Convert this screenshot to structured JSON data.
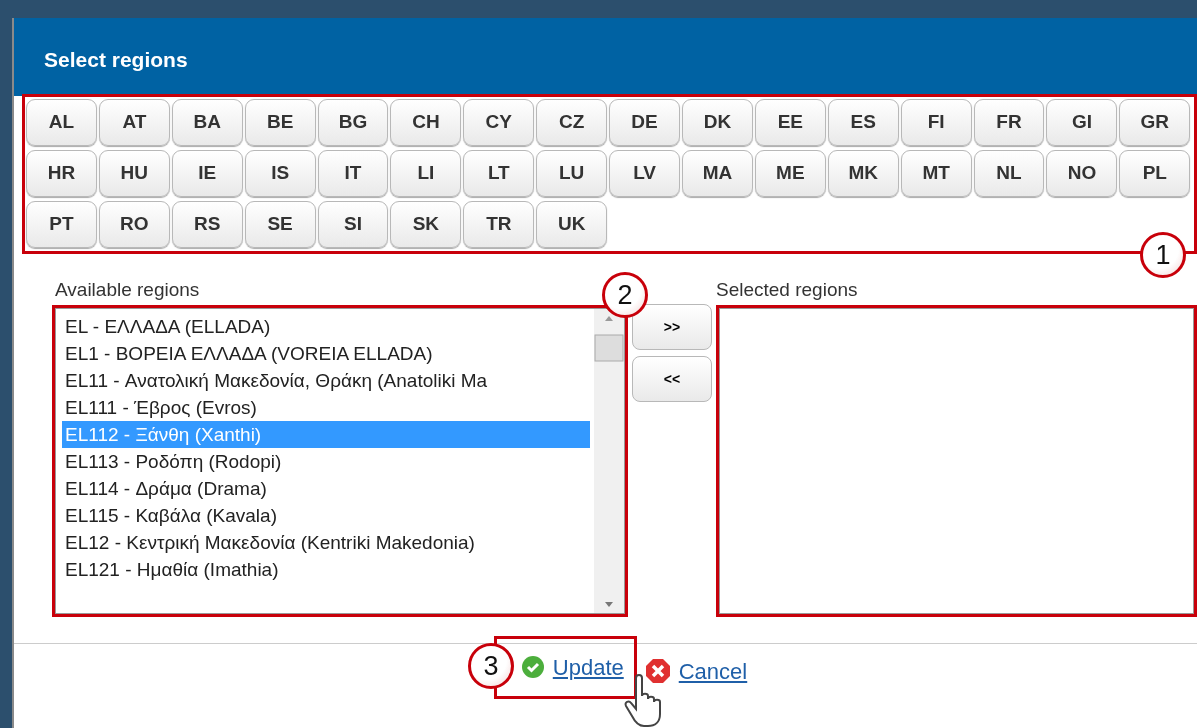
{
  "dialog": {
    "title": "Select regions"
  },
  "country_buttons": [
    "AL",
    "AT",
    "BA",
    "BE",
    "BG",
    "CH",
    "CY",
    "CZ",
    "DE",
    "DK",
    "EE",
    "ES",
    "FI",
    "FR",
    "GI",
    "GR",
    "HR",
    "HU",
    "IE",
    "IS",
    "IT",
    "LI",
    "LT",
    "LU",
    "LV",
    "MA",
    "ME",
    "MK",
    "MT",
    "NL",
    "NO",
    "PL",
    "PT",
    "RO",
    "RS",
    "SE",
    "SI",
    "SK",
    "TR",
    "UK"
  ],
  "available": {
    "label": "Available regions",
    "items": [
      {
        "text": "EL - ΕΛΛΑΔΑ (ELLADA)",
        "selected": false
      },
      {
        "text": "EL1 - ΒΟΡΕΙΑ ΕΛΛΑΔΑ (VOREIA ELLADA)",
        "selected": false
      },
      {
        "text": "EL11 - Ανατολική Μακεδονία, Θράκη (Anatoliki Ma",
        "selected": false
      },
      {
        "text": "EL111 - Έβρος (Evros)",
        "selected": false
      },
      {
        "text": "EL112 - Ξάνθη (Xanthi)",
        "selected": true
      },
      {
        "text": "EL113 - Ροδόπη (Rodopi)",
        "selected": false
      },
      {
        "text": "EL114 - Δράμα (Drama)",
        "selected": false
      },
      {
        "text": "EL115 - Καβάλα (Kavala)",
        "selected": false
      },
      {
        "text": "EL12 - Κεντρική Μακεδονία (Kentriki Makedonia)",
        "selected": false
      },
      {
        "text": "EL121 - Ημαθία (Imathia)",
        "selected": false
      }
    ]
  },
  "move_buttons": [
    ">>",
    "<<"
  ],
  "selected": {
    "label": "Selected regions"
  },
  "footer": {
    "update": "Update",
    "cancel": "Cancel"
  },
  "callouts": [
    "1",
    "2",
    "3"
  ]
}
